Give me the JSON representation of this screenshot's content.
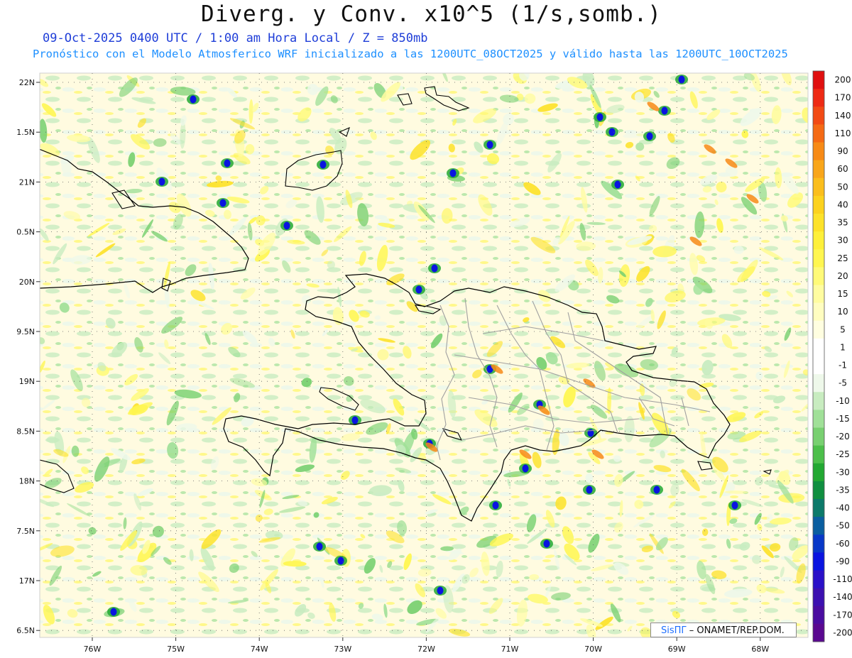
{
  "header": {
    "title": "Diverg. y Conv. x10^5 (1/s,somb.)",
    "line1": "09-Oct-2025  0400 UTC / 1:00 am Hora Local / Z = 850mb",
    "line2": "Pronóstico con el Modelo Atmosferico WRF inicializado a las 1200UTC_08OCT2025 y válido hasta las  1200UTC_10OCT2025"
  },
  "axes": {
    "lat_labels": [
      "22N",
      "1.5N",
      "21N",
      "0.5N",
      "20N",
      "9.5N",
      "19N",
      "8.5N",
      "18N",
      "7.5N",
      "17N",
      "6.5N"
    ],
    "lon_labels": [
      "76W",
      "75W",
      "74W",
      "73W",
      "72W",
      "71W",
      "70W",
      "69W",
      "68W"
    ]
  },
  "colorbar": {
    "labels": [
      "200",
      "170",
      "140",
      "110",
      "90",
      "60",
      "50",
      "40",
      "35",
      "30",
      "25",
      "20",
      "15",
      "10",
      "5",
      "1",
      "-1",
      "-5",
      "-10",
      "-15",
      "-20",
      "-25",
      "-30",
      "-35",
      "-40",
      "-50",
      "-60",
      "-90",
      "-110",
      "-140",
      "-170",
      "-200"
    ],
    "colors": [
      "#e01010",
      "#ee2a14",
      "#f24a14",
      "#f56a14",
      "#f78a16",
      "#f9a61a",
      "#fbbe1c",
      "#fcd21e",
      "#fde22a",
      "#fef03a",
      "#fff650",
      "#fffa78",
      "#fffca0",
      "#fffdc0",
      "#fffee0",
      "#ffffff",
      "#ffffff",
      "#eef8ea",
      "#c8ecc0",
      "#a0e098",
      "#78d070",
      "#4cbf4a",
      "#22a832",
      "#108f40",
      "#0c7a6a",
      "#0a5ea0",
      "#0838c8",
      "#0a14e0",
      "#2a10c8",
      "#3c10b0",
      "#4a0ca0",
      "#5a0890"
    ]
  },
  "credit": {
    "brand": "SisПΓ",
    "text": "– ONAMET/REP.DOM."
  },
  "colors": {
    "coast": "#000000",
    "provinces": "#a0a0a0",
    "grid": "#606060",
    "bg_fill": "#fffbe0"
  }
}
